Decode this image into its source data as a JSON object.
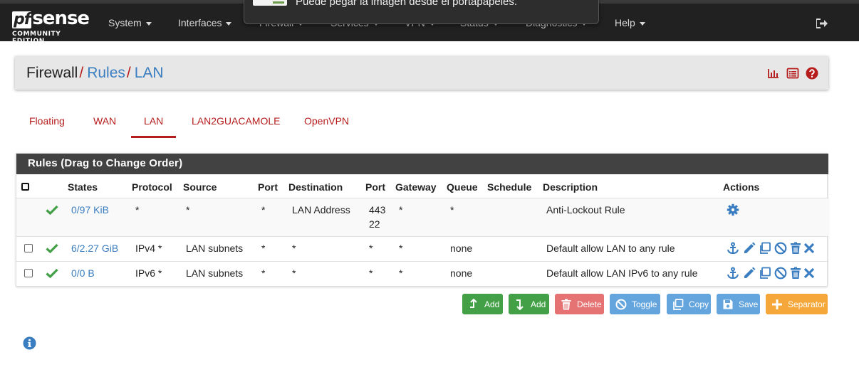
{
  "brand": {
    "logo_pf": "pf",
    "logo_sense": "sense",
    "edition": "COMMUNITY EDITION"
  },
  "nav": {
    "items": [
      "System",
      "Interfaces",
      "Firewall",
      "Services",
      "VPN",
      "Status",
      "Diagnostics",
      "Help"
    ]
  },
  "toast": {
    "text": "Puede pegar la imagen desde el portapapeles."
  },
  "breadcrumb": {
    "root": "Firewall",
    "sep": "/",
    "rules": "Rules",
    "lan": "LAN"
  },
  "tabs": [
    "Floating",
    "WAN",
    "LAN",
    "LAN2GUACAMOLE",
    "OpenVPN"
  ],
  "active_tab": "LAN",
  "rules_panel": {
    "title": "Rules (Drag to Change Order)",
    "columns": [
      "States",
      "Protocol",
      "Source",
      "Port",
      "Destination",
      "Port",
      "Gateway",
      "Queue",
      "Schedule",
      "Description",
      "Actions"
    ],
    "rows": [
      {
        "states": "0/97 KiB",
        "protocol": "*",
        "source": "*",
        "port": "*",
        "destination": "LAN Address",
        "dport": "443",
        "dport2": "22",
        "gateway": "*",
        "queue": "*",
        "schedule": "",
        "description": "Anti-Lockout Rule"
      },
      {
        "states": "6/2.27 GiB",
        "protocol": "IPv4 *",
        "source": "LAN subnets",
        "port": "*",
        "destination": "*",
        "dport": "*",
        "gateway": "*",
        "queue": "none",
        "schedule": "",
        "description": "Default allow LAN to any rule"
      },
      {
        "states": "0/0 B",
        "protocol": "IPv6 *",
        "source": "LAN subnets",
        "port": "*",
        "destination": "*",
        "dport": "*",
        "gateway": "*",
        "queue": "none",
        "schedule": "",
        "description": "Default allow LAN IPv6 to any rule"
      }
    ]
  },
  "buttons": {
    "add_top": "Add",
    "add_bottom": "Add",
    "delete": "Delete",
    "toggle": "Toggle",
    "copy": "Copy",
    "save": "Save",
    "separator": "Separator"
  },
  "colors": {
    "navbar": "#212121",
    "accent_red": "#b71c1c",
    "link_blue": "#3a7dc0",
    "panel_header": "#424242",
    "btn_green": "#43a047",
    "btn_red": "#e57373",
    "btn_blue": "#64a5dd",
    "btn_orange": "#f6a73a"
  }
}
